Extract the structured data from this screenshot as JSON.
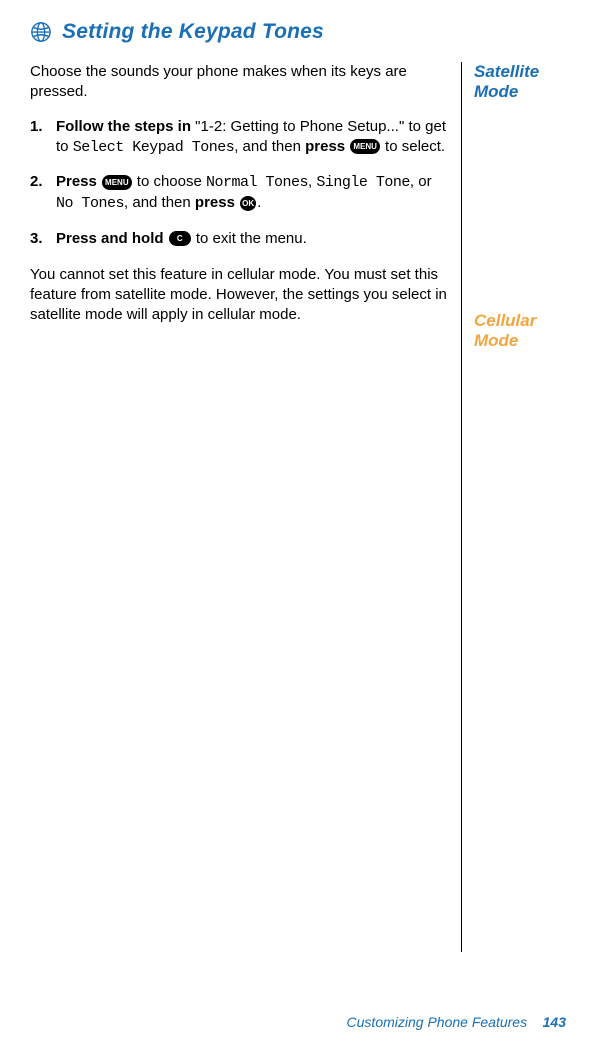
{
  "heading": "Setting the Keypad Tones",
  "sidebar": {
    "satellite": "Satellite Mode",
    "cellular": "Cellular Mode"
  },
  "intro": "Choose the sounds your phone makes when its keys are pressed.",
  "steps": [
    {
      "lead_bold": "Follow the steps in",
      "text1": " \"1-2: Getting to Phone Setup...\" to get to ",
      "lcd1": "Select Keypad Tones",
      "text2": ", and then ",
      "bold2": "press",
      "key": "MENU",
      "tail": " to select."
    },
    {
      "lead_bold": "Press",
      "key1": "MENU",
      "text1": " to choose ",
      "lcd1": "Normal Tones",
      "sep1": ", ",
      "lcd2": "Single Tone",
      "sep2": ", or ",
      "lcd3": "No Tones",
      "text2": ", and then ",
      "bold2": "press",
      "key2": "OK",
      "tail": "."
    },
    {
      "lead_bold": "Press and hold",
      "key": "C",
      "tail": " to exit the menu."
    }
  ],
  "cellular_para": "You cannot set this feature in cellular mode. You must set this feature from satellite mode. However, the settings you select in satellite mode will apply in cellular mode.",
  "footer": {
    "chapter": "Customizing Phone Features",
    "page": "143"
  }
}
